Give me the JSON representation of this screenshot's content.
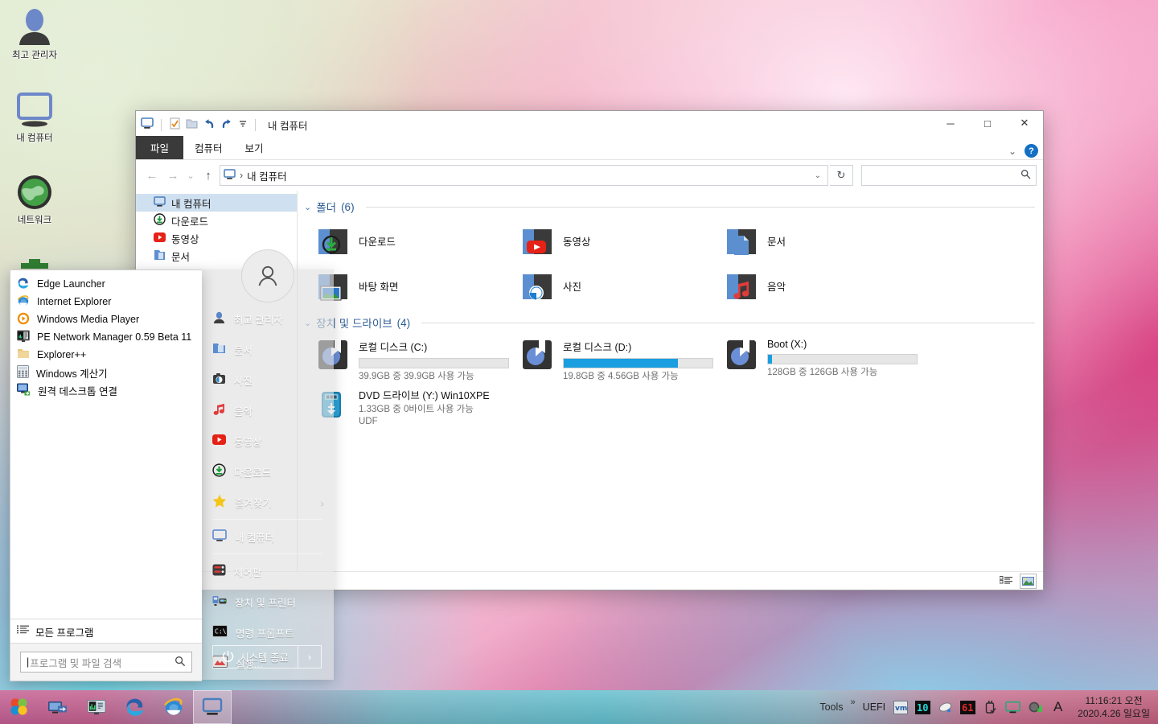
{
  "desktop": {
    "icons": [
      {
        "name": "user-admin",
        "label": "최고 관리자"
      },
      {
        "name": "my-computer",
        "label": "내 컴퓨터"
      },
      {
        "name": "network",
        "label": "네트워크"
      },
      {
        "name": "recycle-bin",
        "label": ""
      }
    ]
  },
  "explorer": {
    "titlebar": {
      "title": "내 컴퓨터",
      "qat": [
        "computer-icon",
        "properties-icon",
        "new-folder-icon",
        "undo-icon",
        "redo-icon",
        "customize-caret-icon"
      ],
      "minimize": "─",
      "maximize": "□",
      "close": "✕"
    },
    "ribbon": {
      "tabs": [
        {
          "label": "파일",
          "active": true
        },
        {
          "label": "컴퓨터",
          "active": false
        },
        {
          "label": "보기",
          "active": false
        }
      ],
      "collapse": "⌄",
      "help": "?"
    },
    "navbar": {
      "back": "←",
      "forward": "→",
      "recent": "⌄",
      "up": "↑",
      "breadcrumb": [
        "내 컴퓨터"
      ],
      "separator": "›",
      "dropdown": "⌄",
      "refresh": "↻",
      "search_placeholder": "",
      "search_value": "",
      "search_icon": "🔍"
    },
    "navpane": {
      "items": [
        {
          "label": "내 컴퓨터",
          "icon": "monitor-icon",
          "selected": true
        },
        {
          "label": "다운로드",
          "icon": "download-icon",
          "selected": false
        },
        {
          "label": "동영상",
          "icon": "video-icon",
          "selected": false
        },
        {
          "label": "문서",
          "icon": "document-icon",
          "selected": false
        }
      ]
    },
    "groups": [
      {
        "title": "폴더",
        "count": "(6)",
        "chevron": "⌄",
        "items": [
          {
            "label": "다운로드",
            "icon": "folder-download"
          },
          {
            "label": "동영상",
            "icon": "folder-video"
          },
          {
            "label": "문서",
            "icon": "folder-document"
          },
          {
            "label": "바탕 화면",
            "icon": "folder-desktop"
          },
          {
            "label": "사진",
            "icon": "folder-pictures"
          },
          {
            "label": "음악",
            "icon": "folder-music"
          }
        ]
      },
      {
        "title": "장치 및 드라이브",
        "count": "(4)",
        "chevron": "⌄",
        "drives": [
          {
            "name": "로컬 디스크 (C:)",
            "usage": "39.9GB 중 39.9GB 사용 가능",
            "fill_percent": 0,
            "has_bar": true,
            "fs": "",
            "icon": "hdd-icon"
          },
          {
            "name": "로컬 디스크 (D:)",
            "usage": "19.8GB 중 4.56GB 사용 가능",
            "fill_percent": 77,
            "has_bar": true,
            "fs": "",
            "icon": "hdd-icon"
          },
          {
            "name": "Boot (X:)",
            "usage": "128GB 중 126GB 사용 가능",
            "fill_percent": 2,
            "has_bar": true,
            "fs": "",
            "icon": "hdd-icon"
          },
          {
            "name": "DVD 드라이브 (Y:) Win10XPE",
            "usage": "1.33GB 중 0바이트 사용 가능",
            "fill_percent": 100,
            "has_bar": false,
            "fs": "UDF",
            "icon": "usb-drive-icon"
          }
        ]
      }
    ],
    "statusbar": {
      "view_details": "details-view-icon",
      "view_large": "large-icons-view-icon"
    }
  },
  "startmenu": {
    "programs": [
      {
        "label": "Edge Launcher",
        "icon": "edge-icon"
      },
      {
        "label": "Internet Explorer",
        "icon": "ie-icon"
      },
      {
        "label": "Windows Media Player",
        "icon": "wmp-icon"
      },
      {
        "label": "PE Network Manager 0.59 Beta 11",
        "icon": "network-manager-icon"
      },
      {
        "label": "Explorer++",
        "icon": "folder-icon"
      },
      {
        "label": "Windows 계산기",
        "icon": "calculator-icon"
      },
      {
        "label": "원격 데스크톱 연결",
        "icon": "remote-desktop-icon"
      }
    ],
    "all_programs": "모든 프로그램",
    "all_programs_icon": "list-icon",
    "search_placeholder": "프로그램 및 파일 검색",
    "search_icon": "🔍",
    "user": "최고 관리자",
    "right_items": [
      {
        "label": "최고 관리자",
        "icon": "user-icon",
        "arrow": false,
        "sep_after": false
      },
      {
        "label": "문서",
        "icon": "documents-icon",
        "arrow": false,
        "sep_after": false
      },
      {
        "label": "사진",
        "icon": "pictures-icon",
        "arrow": false,
        "sep_after": false
      },
      {
        "label": "음악",
        "icon": "music-icon",
        "arrow": false,
        "sep_after": false
      },
      {
        "label": "동영상",
        "icon": "video-icon",
        "arrow": false,
        "sep_after": false
      },
      {
        "label": "다운로드",
        "icon": "download-icon",
        "arrow": false,
        "sep_after": false
      },
      {
        "label": "즐겨찾기",
        "icon": "star-icon",
        "arrow": true,
        "sep_after": true
      },
      {
        "label": "내 컴퓨터",
        "icon": "monitor-icon",
        "arrow": false,
        "sep_after": true
      },
      {
        "label": "제어판",
        "icon": "control-panel-icon",
        "arrow": false,
        "sep_after": false
      },
      {
        "label": "장치 및 프린터",
        "icon": "devices-printers-icon",
        "arrow": false,
        "sep_after": false
      },
      {
        "label": "명령 프롬프트",
        "icon": "cmd-icon",
        "arrow": false,
        "sep_after": false
      },
      {
        "label": "실행...",
        "icon": "run-icon",
        "arrow": false,
        "sep_after": false
      }
    ],
    "power": {
      "label": "시스템 종료",
      "arrow": "›",
      "icon": "power-icon"
    }
  },
  "taskbar": {
    "start_icon": "windows-start-icon",
    "pinned": [
      {
        "name": "start-button",
        "icon": "windows-start-icon",
        "active": false
      },
      {
        "name": "network-share",
        "icon": "network-share-icon",
        "active": false
      },
      {
        "name": "pe-network-manager",
        "icon": "network-manager-icon",
        "active": false
      },
      {
        "name": "edge",
        "icon": "edge-icon",
        "active": false
      },
      {
        "name": "internet-explorer",
        "icon": "ie-icon",
        "active": false
      },
      {
        "name": "explorer-window",
        "icon": "monitor-icon",
        "active": true
      }
    ],
    "tools_label": "Tools",
    "overflow": "»",
    "uefi_label": "UEFI",
    "tray": [
      {
        "name": "vm-icon"
      },
      {
        "name": "resource-monitor-icon"
      },
      {
        "name": "mouse-icon"
      },
      {
        "name": "cpu-temp-icon"
      },
      {
        "name": "usb-eject-icon"
      },
      {
        "name": "display-icon"
      },
      {
        "name": "network-status-icon"
      },
      {
        "name": "ime-indicator-icon"
      }
    ],
    "ime": "A",
    "time": "11:16:21 오전",
    "date": "2020.4.26 일요일"
  },
  "colors": {
    "accent_blue": "#1a9ee0",
    "group_header": "#2c5c94",
    "file_tab": "#3a3a3a",
    "selection": "#cfe0f0"
  }
}
